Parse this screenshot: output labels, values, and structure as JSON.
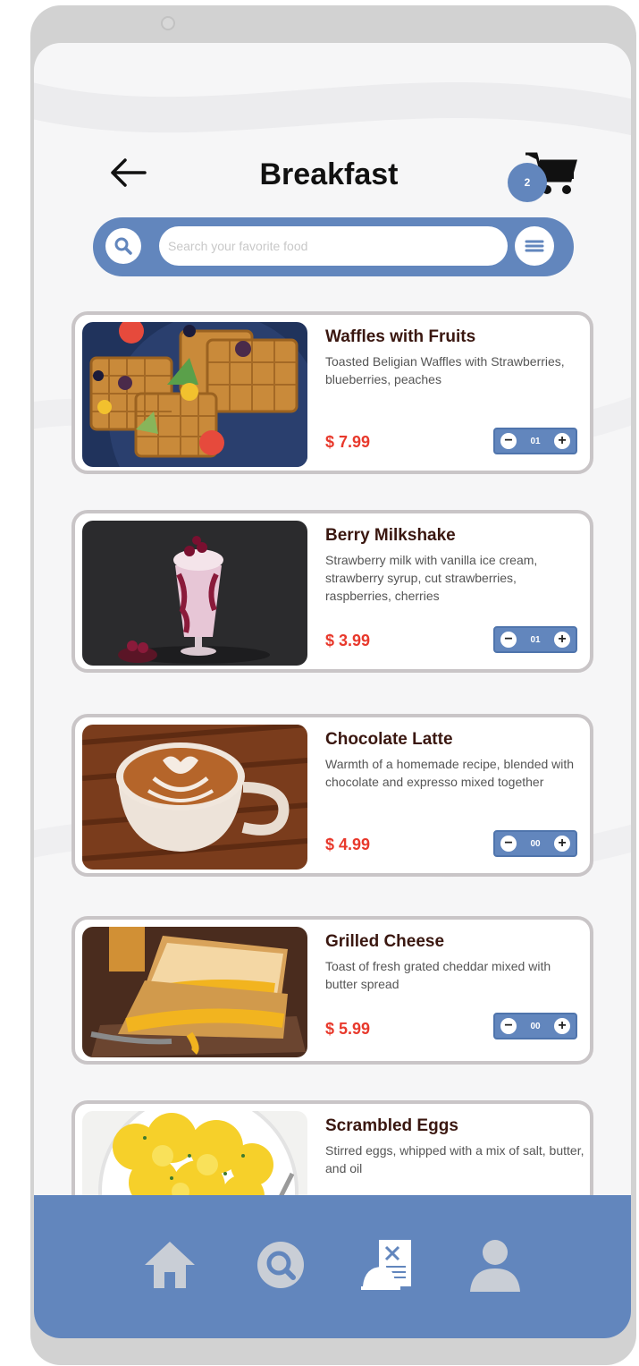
{
  "header": {
    "title": "Breakfast",
    "cart_count": "2"
  },
  "search": {
    "placeholder": "Search your favorite food",
    "value": ""
  },
  "items": [
    {
      "name": "Waffles with Fruits",
      "description": "Toasted Beligian Waffles with Strawberries, blueberries, peaches",
      "price": "$ 7.99",
      "quantity": "01",
      "image": "waffles-with-fruits"
    },
    {
      "name": "Berry Milkshake",
      "description": "Strawberry milk with vanilla ice cream, strawberry syrup, cut strawberries, raspberries, cherries",
      "price": "$ 3.99",
      "quantity": "01",
      "image": "berry-milkshake"
    },
    {
      "name": "Chocolate Latte",
      "description": "Warmth of a homemade recipe, blended with chocolate and expresso mixed together",
      "price": "$ 4.99",
      "quantity": "00",
      "image": "latte-art-cup"
    },
    {
      "name": "Grilled Cheese",
      "description": "Toast of fresh grated cheddar mixed with butter spread",
      "price": "$ 5.99",
      "quantity": "00",
      "image": "grilled-cheese-sandwich"
    },
    {
      "name": "Scrambled Eggs",
      "description": "Stirred eggs, whipped with a mix of salt, butter, and oil",
      "image": "scrambled-eggs"
    }
  ],
  "stepper_symbols": {
    "minus": "−",
    "plus": "+"
  },
  "nav": [
    {
      "icon": "home-icon"
    },
    {
      "icon": "search-icon"
    },
    {
      "icon": "menu-dish-icon"
    },
    {
      "icon": "profile-icon"
    }
  ],
  "colors": {
    "accent": "#6286bd",
    "price": "#e8392c",
    "title": "#3a1710",
    "card_border": "#c9c5c7"
  }
}
